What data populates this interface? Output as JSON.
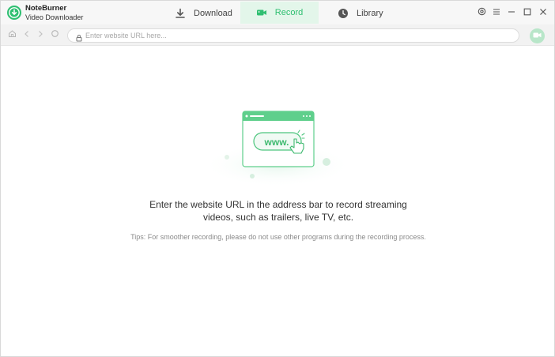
{
  "app": {
    "name": "NoteBurner",
    "subtitle": "Video Downloader"
  },
  "tabs": [
    {
      "label": "Download",
      "icon": "download-icon",
      "active": false
    },
    {
      "label": "Record",
      "icon": "record-icon",
      "active": true
    },
    {
      "label": "Library",
      "icon": "clock-icon",
      "active": false
    }
  ],
  "window_controls": [
    "settings-icon",
    "menu-icon",
    "minimize-icon",
    "maximize-icon",
    "close-icon"
  ],
  "navbar": {
    "url_value": "",
    "url_placeholder": "Enter website URL here..."
  },
  "content": {
    "illustration_text": "www.",
    "headline_line1": "Enter the website URL in the address bar to record streaming",
    "headline_line2": "videos, such as trailers, live TV, etc.",
    "tips": "Tips: For smoother recording, please do not use other programs during the recording process."
  },
  "colors": {
    "accent": "#2fbf71",
    "accent_light": "#e3f6ea",
    "record_button": "#b8e6c9"
  }
}
